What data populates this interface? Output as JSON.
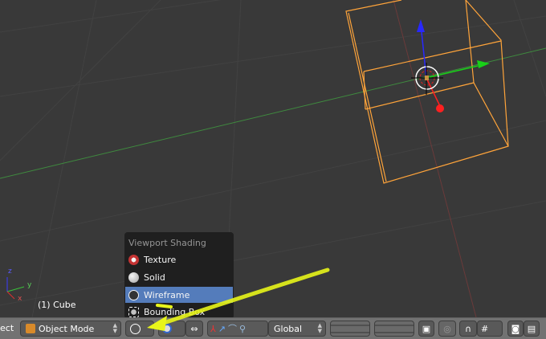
{
  "viewport": {
    "object_label": "(1) Cube",
    "axis_labels": {
      "x": "x",
      "y": "y",
      "z": "z"
    }
  },
  "shading_menu": {
    "title": "Viewport Shading",
    "items": [
      {
        "label": "Texture",
        "icon": "texture-icon"
      },
      {
        "label": "Solid",
        "icon": "solid-icon"
      },
      {
        "label": "Wireframe",
        "icon": "wireframe-icon",
        "selected": true
      },
      {
        "label": "Bounding Box",
        "icon": "bounding-box-icon"
      }
    ]
  },
  "toolbar": {
    "menu_fragment": "ect",
    "mode": "Object Mode",
    "orientation": "Global"
  },
  "colors": {
    "selection": "#ffa43a",
    "menu_highlight": "#5680c2",
    "annotation": "#e8f51a"
  }
}
